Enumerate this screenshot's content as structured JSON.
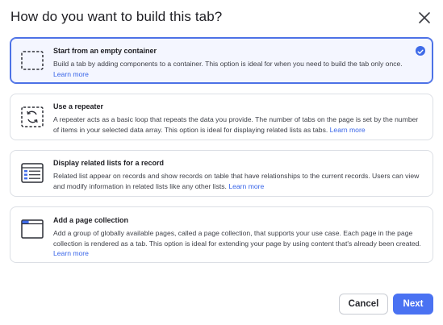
{
  "dialog": {
    "title": "How do you want to build this tab?",
    "close_icon": "close-icon"
  },
  "options": [
    {
      "title": "Start from an empty container",
      "description": "Build a tab by adding components to a container. This option is ideal for when you need to build the tab only once.",
      "learn_more": "Learn more",
      "icon": "empty-container-icon",
      "selected": true
    },
    {
      "title": "Use a repeater",
      "description": "A repeater acts as a basic loop that repeats the data you provide. The number of tabs on the page is set by the number of items in your selected data array. This option is ideal for displaying related lists as tabs.",
      "learn_more": "Learn more",
      "icon": "repeater-icon",
      "selected": false
    },
    {
      "title": "Display related lists for a record",
      "description": "Related list appear on records and show records on table that have relationships to the current records. Users can view and modify information in related lists like any other lists.",
      "learn_more": "Learn more",
      "icon": "related-list-icon",
      "selected": false
    },
    {
      "title": "Add a page collection",
      "description": "Add a group of globally available pages, called a page collection, that supports your use case. Each page in the page collection is rendered as a tab. This option is ideal for extending your page by using content that's already been created.",
      "learn_more": "Learn more",
      "icon": "page-collection-icon",
      "selected": false
    }
  ],
  "footer": {
    "cancel_label": "Cancel",
    "next_label": "Next"
  },
  "colors": {
    "accent": "#4a72f2",
    "selected_border": "#4d72e6",
    "link": "#3764e8"
  }
}
